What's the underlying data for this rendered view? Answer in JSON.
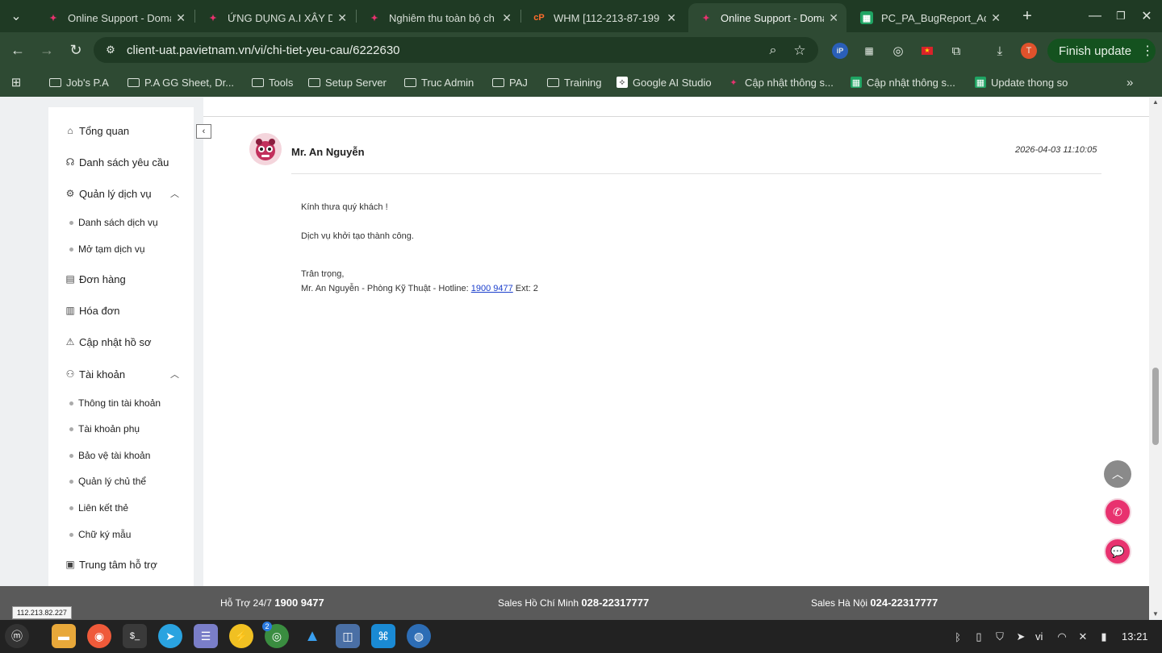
{
  "browser": {
    "tabs": [
      {
        "title": "Online Support - Doma",
        "favicon": "pa-logo-icon",
        "active": false
      },
      {
        "title": "ỨNG DỤNG A.I XÂY DỰ",
        "favicon": "pa-logo-icon",
        "active": false
      },
      {
        "title": "Nghiêm thu toàn bộ ch",
        "favicon": "pa-logo-icon",
        "active": false
      },
      {
        "title": "WHM [112-213-87-199",
        "favicon": "cpanel-icon",
        "active": false
      },
      {
        "title": "Online Support - Doma",
        "favicon": "pa-logo-icon",
        "active": true
      },
      {
        "title": "PC_PA_BugReport_Ad",
        "favicon": "sheets-icon",
        "active": false
      }
    ],
    "url": "client-uat.pavietnam.vn/vi/chi-tiet-yeu-cau/6222630",
    "profile_initial": "T",
    "finish_update_label": "Finish update",
    "bookmarks": [
      {
        "label": "Job's P.A",
        "icon": "folder-icon"
      },
      {
        "label": "P.A GG Sheet, Dr...",
        "icon": "folder-icon"
      },
      {
        "label": "Tools",
        "icon": "folder-icon"
      },
      {
        "label": "Setup Server",
        "icon": "folder-icon"
      },
      {
        "label": "Truc Admin",
        "icon": "folder-icon"
      },
      {
        "label": "PAJ",
        "icon": "folder-icon"
      },
      {
        "label": "Training",
        "icon": "folder-icon"
      },
      {
        "label": "Google AI Studio",
        "icon": "ai-studio-icon"
      },
      {
        "label": "Cập nhật thông s...",
        "icon": "pa-logo-icon"
      },
      {
        "label": "Cập nhật thông s...",
        "icon": "sheets-icon"
      },
      {
        "label": "Update thong so",
        "icon": "sheets-icon"
      }
    ]
  },
  "sidebar": {
    "items": [
      {
        "label": "Tổng quan",
        "icon": "home-icon"
      },
      {
        "label": "Danh sách yêu cầu",
        "icon": "headset-icon"
      },
      {
        "label": "Quản lý dịch vụ",
        "icon": "gear-icon"
      },
      {
        "label": "Danh sách dịch vụ",
        "sub": true
      },
      {
        "label": "Mở tạm dịch vụ",
        "sub": true
      },
      {
        "label": "Đơn hàng",
        "icon": "clipboard-icon"
      },
      {
        "label": "Hóa đơn",
        "icon": "invoice-icon"
      },
      {
        "label": "Cập nhật hồ sơ",
        "icon": "warning-icon"
      },
      {
        "label": "Tài khoản",
        "icon": "user-icon"
      },
      {
        "label": "Thông tin tài khoản",
        "sub": true
      },
      {
        "label": "Tài khoản phụ",
        "sub": true
      },
      {
        "label": "Bảo vệ tài khoản",
        "sub": true
      },
      {
        "label": "Quản lý chủ thể",
        "sub": true
      },
      {
        "label": "Liên kết thẻ",
        "sub": true
      },
      {
        "label": "Chữ ký mẫu",
        "sub": true
      },
      {
        "label": "Trung tâm hỗ trợ",
        "icon": "support-center-icon"
      }
    ]
  },
  "ticket": {
    "author": "Mr. An Nguyễn",
    "date": "2026-04-03 11:10:05",
    "greeting": "Kính thưa quý khách !",
    "body": "Dịch vụ khởi tạo thành công.",
    "closing": "Trân trọng,",
    "signature_prefix": "Mr. An Nguyễn - Phòng Kỹ Thuật - Hotline: ",
    "hotline": "1900 9477",
    "ext": " Ext: 2"
  },
  "footer": {
    "support_label": "Hỗ Trợ 24/7",
    "support_number": "1900 9477",
    "hcm_label": "Sales Hồ Chí Minh",
    "hcm_number": "028-22317777",
    "hn_label": "Sales Hà Nội",
    "hn_number": "024-22317777",
    "ip": "112.213.82.227"
  },
  "taskbar": {
    "chrome_badge": "2",
    "lang": "vi",
    "clock": "13:21"
  },
  "colors": {
    "brand": "#e8326f",
    "link": "#1a3ecc",
    "chrome_frame": "#1f3a24"
  }
}
